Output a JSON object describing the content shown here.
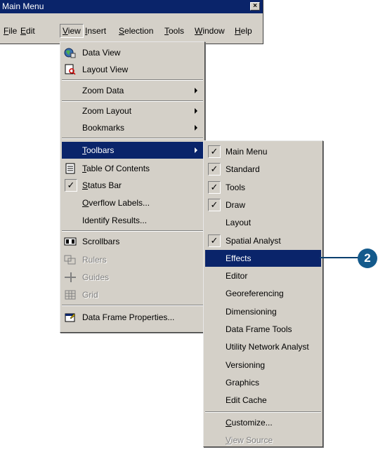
{
  "window": {
    "title": "Main Menu",
    "close_glyph": "×"
  },
  "menubar": [
    {
      "label": "File",
      "ul": "F",
      "rest": "ile"
    },
    {
      "label": "Edit",
      "ul": "E",
      "rest": "dit"
    },
    {
      "label": "View",
      "ul": "V",
      "rest": "iew"
    },
    {
      "label": "Insert",
      "ul": "I",
      "rest": "nsert"
    },
    {
      "label": "Selection",
      "ul": "S",
      "rest": "election"
    },
    {
      "label": "Tools",
      "ul": "T",
      "rest": "ools"
    },
    {
      "label": "Window",
      "ul": "W",
      "rest": "indow"
    },
    {
      "label": "Help",
      "ul": "H",
      "rest": "elp"
    }
  ],
  "view_menu": {
    "data_view": "Data View",
    "layout_view": "Layout View",
    "zoom_data": "Zoom Data",
    "zoom_layout": "Zoom Layout",
    "bookmarks": "Bookmarks",
    "toolbars_u": "T",
    "toolbars_rest": "oolbars",
    "toc_u": "T",
    "toc_rest": "able Of Contents",
    "status_u": "S",
    "status_rest": "tatus Bar",
    "overflow_u": "O",
    "overflow_rest": "verflow Labels...",
    "identify": "Identify Results...",
    "scrollbars": "Scrollbars",
    "rulers": "Rulers",
    "guides": "Guides",
    "grid": "Grid",
    "dfp": "Data Frame Properties...",
    "check_glyph": "✓"
  },
  "toolbars_menu": {
    "items": [
      "Main Menu",
      "Standard",
      "Tools",
      "Draw",
      "Layout",
      "Spatial Analyst",
      "Effects",
      "Editor",
      "Georeferencing",
      "Dimensioning",
      "Data Frame Tools",
      "Utility Network Analyst",
      "Versioning",
      "Graphics",
      "Edit Cache"
    ],
    "checked": [
      true,
      true,
      true,
      true,
      false,
      true,
      false,
      false,
      false,
      false,
      false,
      false,
      false,
      false,
      false
    ],
    "highlighted_index": 6,
    "customize_u": "C",
    "customize_rest": "ustomize...",
    "viewsource_u": "V",
    "viewsource_rest": "iew Source"
  },
  "callout": {
    "number": "2"
  },
  "colors": {
    "highlight": "#0a246a",
    "menu_bg": "#d4d0c8",
    "callout": "#145a8c"
  }
}
